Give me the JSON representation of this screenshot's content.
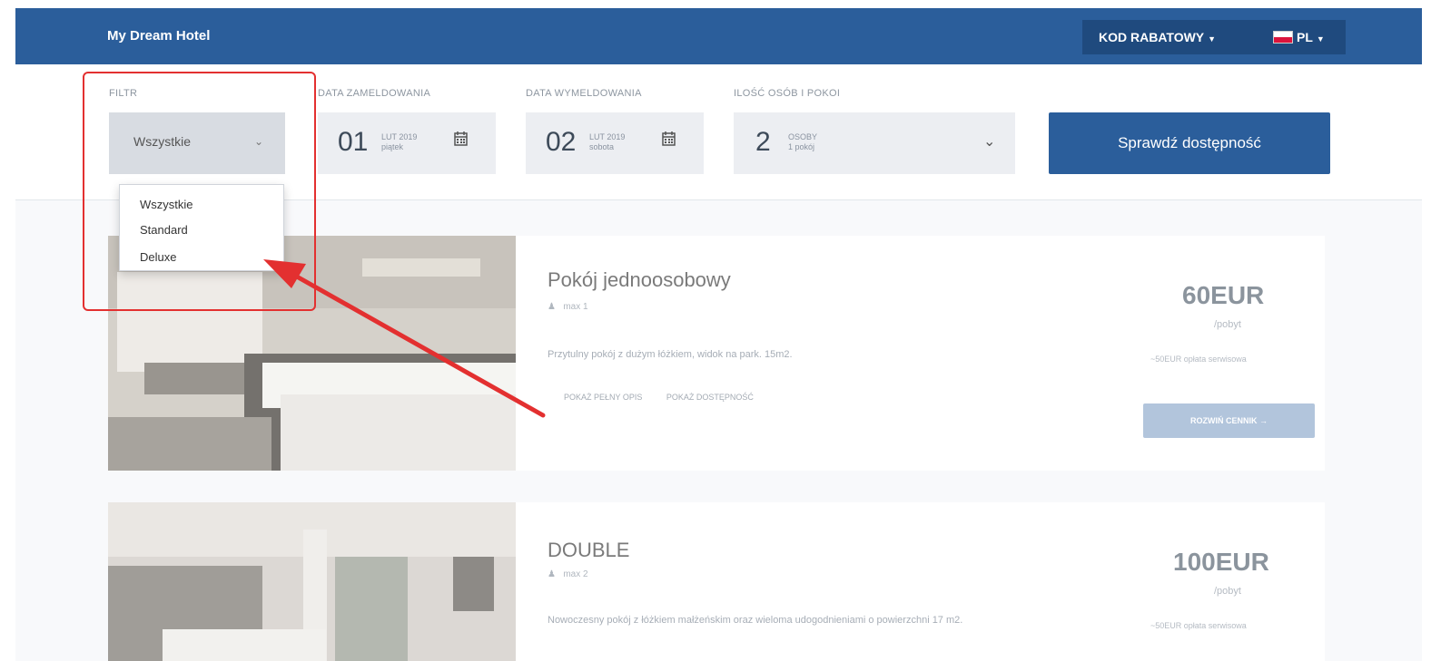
{
  "header": {
    "brand": "My Dream Hotel",
    "promo_label": "KOD RABATOWY",
    "lang_label": "PL"
  },
  "search": {
    "filter": {
      "label": "FILTR",
      "value": "Wszystkie"
    },
    "checkin": {
      "label": "DATA ZAMELDOWANIA",
      "day": "01",
      "month_year": "LUT 2019",
      "weekday": "piątek"
    },
    "checkout": {
      "label": "DATA WYMELDOWANIA",
      "day": "02",
      "month_year": "LUT 2019",
      "weekday": "sobota"
    },
    "guests": {
      "label": "ILOŚĆ OSÓB I POKOI",
      "count": "2",
      "unit": "OSOBY",
      "rooms": "1 pokój"
    },
    "submit_label": "Sprawdź dostępność"
  },
  "filter_dropdown": {
    "options": [
      "Wszystkie",
      "Standard",
      "Deluxe"
    ]
  },
  "rooms": [
    {
      "title": "Pokój jednoosobowy",
      "max": "max 1",
      "description": "Przytulny pokój z dużym łóżkiem, widok na park. 15m2.",
      "link_details": "POKAŻ PEŁNY OPIS",
      "link_availability": "POKAŻ DOSTĘPNOŚĆ",
      "price": "60EUR",
      "per": "/pobyt",
      "fee": "~50EUR opłata serwisowa",
      "expand_label": "ROZWIŃ CENNIK →"
    },
    {
      "title": "DOUBLE",
      "max": "max 2",
      "description": "Nowoczesny pokój z łóżkiem małżeńskim oraz wieloma udogodnieniami o powierzchni 17 m2.",
      "price": "100EUR",
      "per": "/pobyt",
      "fee": "~50EUR opłata serwisowa"
    }
  ],
  "colors": {
    "primary": "#2b5e9b",
    "annotation": "#e33030"
  }
}
